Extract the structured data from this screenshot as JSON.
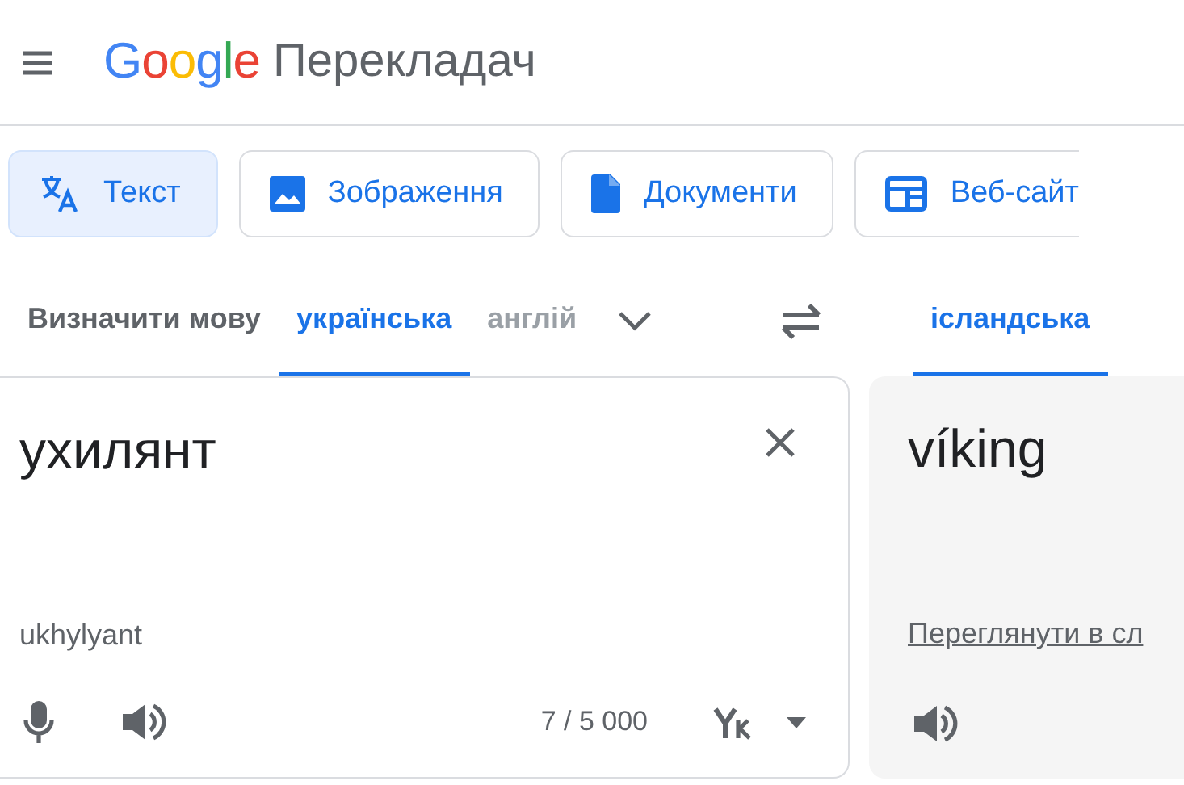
{
  "header": {
    "logo": "Google",
    "product": "Перекладач"
  },
  "modes": [
    {
      "label": "Текст",
      "kind": "text",
      "selected": true
    },
    {
      "label": "Зображення",
      "kind": "image",
      "selected": false
    },
    {
      "label": "Документи",
      "kind": "document",
      "selected": false
    },
    {
      "label": "Веб-сайт",
      "kind": "website",
      "selected": false
    }
  ],
  "source_languages": [
    {
      "label": "Визначити мову",
      "selected": false
    },
    {
      "label": "українська",
      "selected": true
    },
    {
      "label": "англій",
      "selected": false
    }
  ],
  "target_languages": [
    {
      "label": "ісландська",
      "selected": true
    }
  ],
  "source": {
    "text": "ухилянт",
    "transliteration": "ukhylyant",
    "counter": "7 / 5 000"
  },
  "target": {
    "text": "víking",
    "link": "Переглянути в сл"
  }
}
